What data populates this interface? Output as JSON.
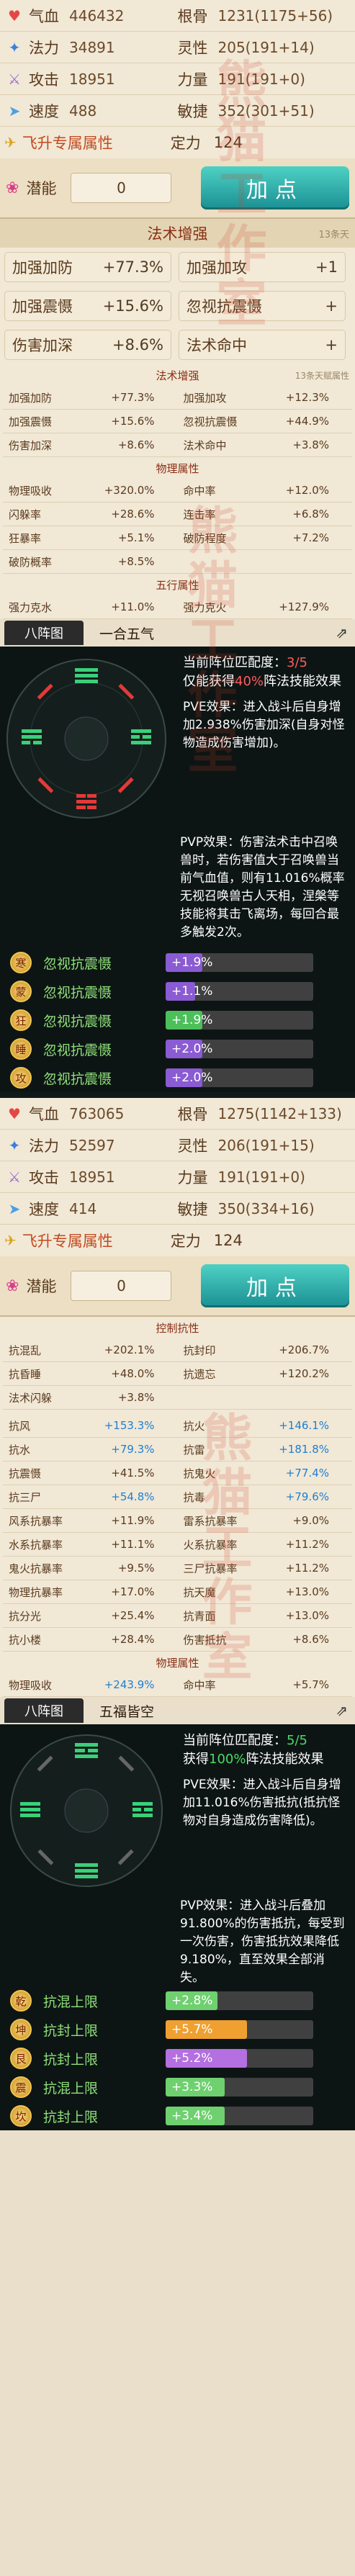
{
  "s1": {
    "stats": [
      [
        {
          "icon": "blood-icon",
          "glyph": "♥",
          "color": "#e64545",
          "label": "气血",
          "value": "446432"
        },
        {
          "label": "根骨",
          "value": "1231(1175+56)"
        }
      ],
      [
        {
          "icon": "mana-icon",
          "glyph": "✦",
          "color": "#3d7fd9",
          "label": "法力",
          "value": "34891"
        },
        {
          "label": "灵性",
          "value": "205(191+14)"
        }
      ],
      [
        {
          "icon": "attack-icon",
          "glyph": "⚔",
          "color": "#9c6ad3",
          "label": "攻击",
          "value": "18951"
        },
        {
          "label": "力量",
          "value": "191(191+0)"
        }
      ],
      [
        {
          "icon": "speed-icon",
          "glyph": "➤",
          "color": "#4aa0e6",
          "label": "速度",
          "value": "488"
        },
        {
          "label": "敏捷",
          "value": "352(301+51)"
        }
      ]
    ],
    "fly_label": "飞升专属属性",
    "fly_key": "定力",
    "fly_val": "124",
    "potential_label": "潜能",
    "potential_val": "0",
    "add_btn": "加点",
    "magic_hdr": "法术增强",
    "magic_hdr_right": "13条天",
    "big": [
      [
        {
          "k": "加强加防",
          "v": "+77.3%"
        },
        {
          "k": "加强加攻",
          "v": "+1"
        }
      ],
      [
        {
          "k": "加强震慑",
          "v": "+15.6%"
        },
        {
          "k": "忽视抗震慑",
          "v": "+"
        }
      ],
      [
        {
          "k": "伤害加深",
          "v": "+8.6%"
        },
        {
          "k": "法术命中",
          "v": "+"
        }
      ]
    ],
    "small_hdr": "法术增强",
    "small_hdr_right": "13条天赋属性",
    "small": [
      {
        "k": "加强加防",
        "v": "+77.3%"
      },
      {
        "k": "加强加攻",
        "v": "+12.3%"
      },
      {
        "k": "加强震慑",
        "v": "+15.6%"
      },
      {
        "k": "忽视抗震慑",
        "v": "+44.9%"
      },
      {
        "k": "伤害加深",
        "v": "+8.6%"
      },
      {
        "k": "法术命中",
        "v": "+3.8%"
      }
    ],
    "phys_hdr": "物理属性",
    "phys": [
      {
        "k": "物理吸收",
        "v": "+320.0%"
      },
      {
        "k": "命中率",
        "v": "+12.0%"
      },
      {
        "k": "闪躲率",
        "v": "+28.6%"
      },
      {
        "k": "连击率",
        "v": "+6.8%"
      },
      {
        "k": "狂暴率",
        "v": "+5.1%"
      },
      {
        "k": "破防程度",
        "v": "+7.2%"
      },
      {
        "k": "破防概率",
        "v": "+8.5%"
      },
      {
        "k": "",
        "v": ""
      }
    ],
    "five_hdr": "五行属性",
    "five": [
      {
        "k": "强力克水",
        "v": "+11.0%"
      },
      {
        "k": "强力克火",
        "v": "+127.9%"
      }
    ]
  },
  "z1": {
    "tab": "八阵图",
    "name": "一合五气",
    "count_label": "当前阵位匹配度：",
    "count": "3/5",
    "gain_pre": "仅能获得",
    "gain_pct": "40%",
    "gain_post": "阵法技能效果",
    "pve": "PVE效果：进入战斗后自身增加2.938%伤害加深(自身对怪物造成伤害增加)。",
    "pvp": "PVP效果：伤害法术击中召唤兽时，若伤害值大于召唤兽当前气血值，则有11.016%概率无视召唤兽古人天相，涅槃等技能将其击飞离场，每回合最多触发2次。",
    "rows": [
      {
        "b": "寒",
        "nm": "忽视抗震慑",
        "v": "+1.9%",
        "c": "#8a5bd3",
        "w": 0.25
      },
      {
        "b": "蒙",
        "nm": "忽视抗震慑",
        "v": "+1.1%",
        "c": "#8a5bd3",
        "w": 0.2
      },
      {
        "b": "狂",
        "nm": "忽视抗震慑",
        "v": "+1.9%",
        "c": "#4cbf5a",
        "w": 0.25
      },
      {
        "b": "睡",
        "nm": "忽视抗震慑",
        "v": "+2.0%",
        "c": "#8a5bd3",
        "w": 0.25
      },
      {
        "b": "攻",
        "nm": "忽视抗震慑",
        "v": "+2.0%",
        "c": "#8a5bd3",
        "w": 0.25
      }
    ]
  },
  "s2": {
    "stats": [
      [
        {
          "icon": "blood-icon",
          "glyph": "♥",
          "color": "#e64545",
          "label": "气血",
          "value": "763065"
        },
        {
          "label": "根骨",
          "value": "1275(1142+133)"
        }
      ],
      [
        {
          "icon": "mana-icon",
          "glyph": "✦",
          "color": "#3d7fd9",
          "label": "法力",
          "value": "52597"
        },
        {
          "label": "灵性",
          "value": "206(191+15)"
        }
      ],
      [
        {
          "icon": "attack-icon",
          "glyph": "⚔",
          "color": "#9c6ad3",
          "label": "攻击",
          "value": "18951"
        },
        {
          "label": "力量",
          "value": "191(191+0)"
        }
      ],
      [
        {
          "icon": "speed-icon",
          "glyph": "➤",
          "color": "#4aa0e6",
          "label": "速度",
          "value": "414"
        },
        {
          "label": "敏捷",
          "value": "350(334+16)"
        }
      ]
    ],
    "fly_label": "飞升专属属性",
    "fly_key": "定力",
    "fly_val": "124",
    "potential_label": "潜能",
    "potential_val": "0",
    "add_btn": "加点",
    "ctrl_hdr": "控制抗性",
    "ctrl": [
      {
        "k": "抗混乱",
        "v": "+202.1%"
      },
      {
        "k": "抗封印",
        "v": "+206.7%"
      },
      {
        "k": "抗昏睡",
        "v": "+48.0%"
      },
      {
        "k": "抗遗忘",
        "v": "+120.2%"
      },
      {
        "k": "法术闪躲",
        "v": "+3.8%"
      },
      {
        "k": "",
        "v": ""
      }
    ],
    "res": [
      {
        "k": "抗风",
        "v": "+153.3%",
        "b": true
      },
      {
        "k": "抗火",
        "v": "+146.1%",
        "b": true
      },
      {
        "k": "抗水",
        "v": "+79.3%",
        "b": true
      },
      {
        "k": "抗雷",
        "v": "+181.8%",
        "b": true
      },
      {
        "k": "抗震慑",
        "v": "+41.5%",
        "b": false
      },
      {
        "k": "抗鬼火",
        "v": "+77.4%",
        "b": true
      },
      {
        "k": "抗三尸",
        "v": "+54.8%",
        "b": true
      },
      {
        "k": "抗毒",
        "v": "+79.6%",
        "b": true
      },
      {
        "k": "风系抗暴率",
        "v": "+11.9%",
        "b": false
      },
      {
        "k": "雷系抗暴率",
        "v": "+9.0%",
        "b": false
      },
      {
        "k": "水系抗暴率",
        "v": "+11.1%",
        "b": false
      },
      {
        "k": "火系抗暴率",
        "v": "+11.2%",
        "b": false
      },
      {
        "k": "鬼火抗暴率",
        "v": "+9.5%",
        "b": false
      },
      {
        "k": "三尸抗暴率",
        "v": "+11.2%",
        "b": false
      },
      {
        "k": "物理抗暴率",
        "v": "+17.0%",
        "b": false
      },
      {
        "k": "抗天魔",
        "v": "+13.0%",
        "b": false
      },
      {
        "k": "抗分光",
        "v": "+25.4%",
        "b": false
      },
      {
        "k": "抗青面",
        "v": "+13.0%",
        "b": false
      },
      {
        "k": "抗小楼",
        "v": "+28.4%",
        "b": false
      },
      {
        "k": "伤害抵抗",
        "v": "+8.6%",
        "b": false
      }
    ],
    "phys_hdr": "物理属性",
    "phys": [
      {
        "k": "物理吸收",
        "v": "+243.9%",
        "b": true
      },
      {
        "k": "命中率",
        "v": "+5.7%",
        "b": false
      }
    ]
  },
  "z2": {
    "tab": "八阵图",
    "name": "五福皆空",
    "count_label": "当前阵位匹配度：",
    "count": "5/5",
    "gain_pre": "获得",
    "gain_pct": "100%",
    "gain_post": "阵法技能效果",
    "pve": "PVE效果：进入战斗后自身增加11.016%伤害抵抗(抵抗怪物对自身造成伤害降低)。",
    "pvp": "PVP效果：进入战斗后叠加91.800%的伤害抵抗，每受到一次伤害，伤害抵抗效果降低9.180%，直至效果全部消失。",
    "rows": [
      {
        "b": "乾",
        "nm": "抗混上限",
        "v": "+2.8%",
        "c": "#6fd06f",
        "w": 0.35
      },
      {
        "b": "坤",
        "nm": "抗封上限",
        "v": "+5.7%",
        "c": "#f0a030",
        "w": 0.55
      },
      {
        "b": "艮",
        "nm": "抗封上限",
        "v": "+5.2%",
        "c": "#b46fe0",
        "w": 0.55
      },
      {
        "b": "震",
        "nm": "抗混上限",
        "v": "+3.3%",
        "c": "#6fd06f",
        "w": 0.4
      },
      {
        "b": "坎",
        "nm": "抗封上限",
        "v": "+3.4%",
        "c": "#6fd06f",
        "w": 0.4
      }
    ]
  },
  "watermark": "熊猫工作室"
}
